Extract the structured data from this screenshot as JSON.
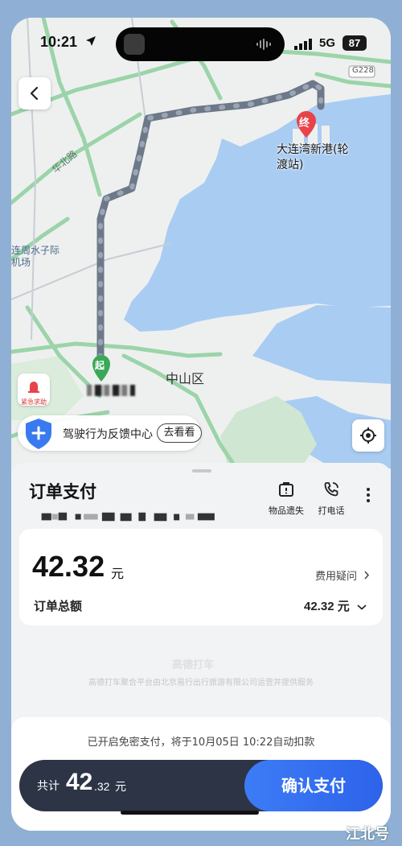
{
  "status_bar": {
    "time": "10:21",
    "network": "5G",
    "battery": "87"
  },
  "map": {
    "destination": "大连湾新港(轮渡站)",
    "district": "中山区",
    "road": "华北路",
    "airport": "连周水子际机场",
    "highway_tag": "G228",
    "end_marker": "终",
    "start_marker": "起",
    "sos_label": "紧急求助",
    "feedback_text": "驾驶行为反馈中心",
    "feedback_button": "去看看"
  },
  "order": {
    "title": "订单支付",
    "actions": [
      {
        "label": "物品遗失",
        "icon": "lost-item-icon"
      },
      {
        "label": "打电话",
        "icon": "phone-icon"
      }
    ],
    "amount": "42.32",
    "amount_unit": "元",
    "fee_question": "费用疑问",
    "total_label": "订单总额",
    "total_value": "42.32 元"
  },
  "footer": {
    "brand": "高德打车",
    "provider_note": "高德打车聚合平台由北京易行出行旅游有限公司运营并提供服务"
  },
  "payment": {
    "note": "已开启免密支付，将于10月05日 10:22自动扣款",
    "prefix": "共计",
    "amount_int": "42",
    "amount_dec": ".32",
    "unit": "元",
    "confirm": "确认支付"
  },
  "watermark": "江北号",
  "colors": {
    "route": "#8f9aaa",
    "accent_blue": "#2d63ea",
    "pay_bar": "#2c3446",
    "end_pin": "#e8434a",
    "start_pin": "#3aa856"
  }
}
